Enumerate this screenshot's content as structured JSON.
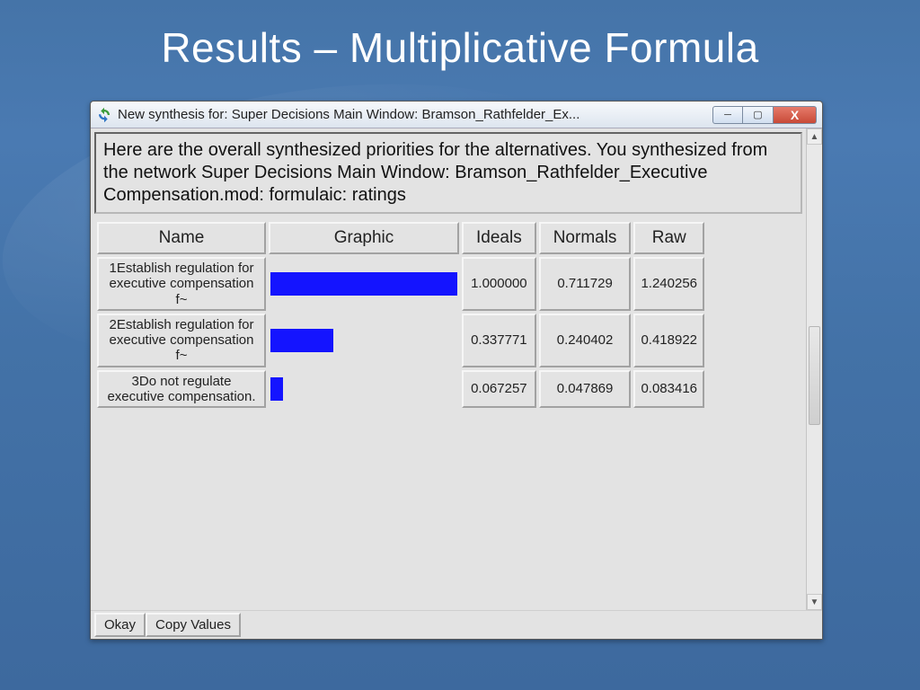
{
  "slide": {
    "title": "Results – Multiplicative Formula"
  },
  "window": {
    "title": "New synthesis for: Super Decisions Main Window: Bramson_Rathfelder_Ex...",
    "controls": {
      "min": "─",
      "max": "▢",
      "close": "X"
    }
  },
  "description": "Here are the overall synthesized priorities for the alternatives. You synthesized from the network Super Decisions Main Window: Bramson_Rathfelder_Executive Compensation.mod: formulaic: ratings",
  "headers": {
    "name": "Name",
    "graphic": "Graphic",
    "ideals": "Ideals",
    "normals": "Normals",
    "raw": "Raw"
  },
  "rows": [
    {
      "name": "1Establish regulation for executive compensation f~",
      "ideals": "1.000000",
      "normals": "0.711729",
      "raw": "1.240256",
      "barPct": 100
    },
    {
      "name": "2Establish regulation for executive compensation f~",
      "ideals": "0.337771",
      "normals": "0.240402",
      "raw": "0.418922",
      "barPct": 33.8
    },
    {
      "name": "3Do not regulate executive compensation.",
      "ideals": "0.067257",
      "normals": "0.047869",
      "raw": "0.083416",
      "barPct": 6.7
    }
  ],
  "footer": {
    "okay": "Okay",
    "copy": "Copy Values"
  },
  "chart_data": {
    "type": "bar",
    "title": "Synthesized priorities for alternatives",
    "categories": [
      "1Establish regulation for executive compensation f~",
      "2Establish regulation for executive compensation f~",
      "3Do not regulate executive compensation."
    ],
    "series": [
      {
        "name": "Ideals",
        "values": [
          1.0,
          0.337771,
          0.067257
        ]
      },
      {
        "name": "Normals",
        "values": [
          0.711729,
          0.240402,
          0.047869
        ]
      },
      {
        "name": "Raw",
        "values": [
          1.240256,
          0.418922,
          0.083416
        ]
      }
    ],
    "xlabel": "",
    "ylabel": "",
    "ylim": [
      0,
      1.25
    ]
  }
}
